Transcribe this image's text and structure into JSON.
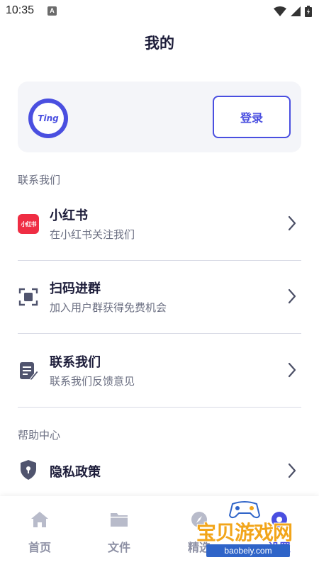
{
  "status_bar": {
    "time": "10:35",
    "notification_letter": "A"
  },
  "page": {
    "title": "我的"
  },
  "profile": {
    "avatar_text": "Ting",
    "login_label": "登录"
  },
  "sections": {
    "contact_title": "联系我们",
    "help_title": "帮助中心"
  },
  "items": [
    {
      "title": "小红书",
      "subtitle": "在小红书关注我们",
      "icon": "xiaohongshu-icon",
      "icon_text": "小红书"
    },
    {
      "title": "扫码进群",
      "subtitle": "加入用户群获得免费机会",
      "icon": "scan-icon"
    },
    {
      "title": "联系我们",
      "subtitle": "联系我们反馈意见",
      "icon": "edit-note-icon"
    }
  ],
  "privacy": {
    "title": "隐私政策",
    "icon": "lock-shield-icon"
  },
  "tabs": [
    {
      "label": "首页",
      "icon": "home-icon",
      "active": false
    },
    {
      "label": "文件",
      "icon": "folder-icon",
      "active": false
    },
    {
      "label": "精选",
      "icon": "explore-icon",
      "active": false
    },
    {
      "label": "设置",
      "icon": "settings-icon",
      "active": true
    }
  ],
  "watermark": {
    "text": "宝贝游戏网",
    "url": "baobeiy.com"
  },
  "colors": {
    "accent": "#4a4fe0",
    "xiaohongshu_red": "#ef2d43",
    "card_bg": "#f4f5f9",
    "muted_text": "#6b6f82"
  }
}
